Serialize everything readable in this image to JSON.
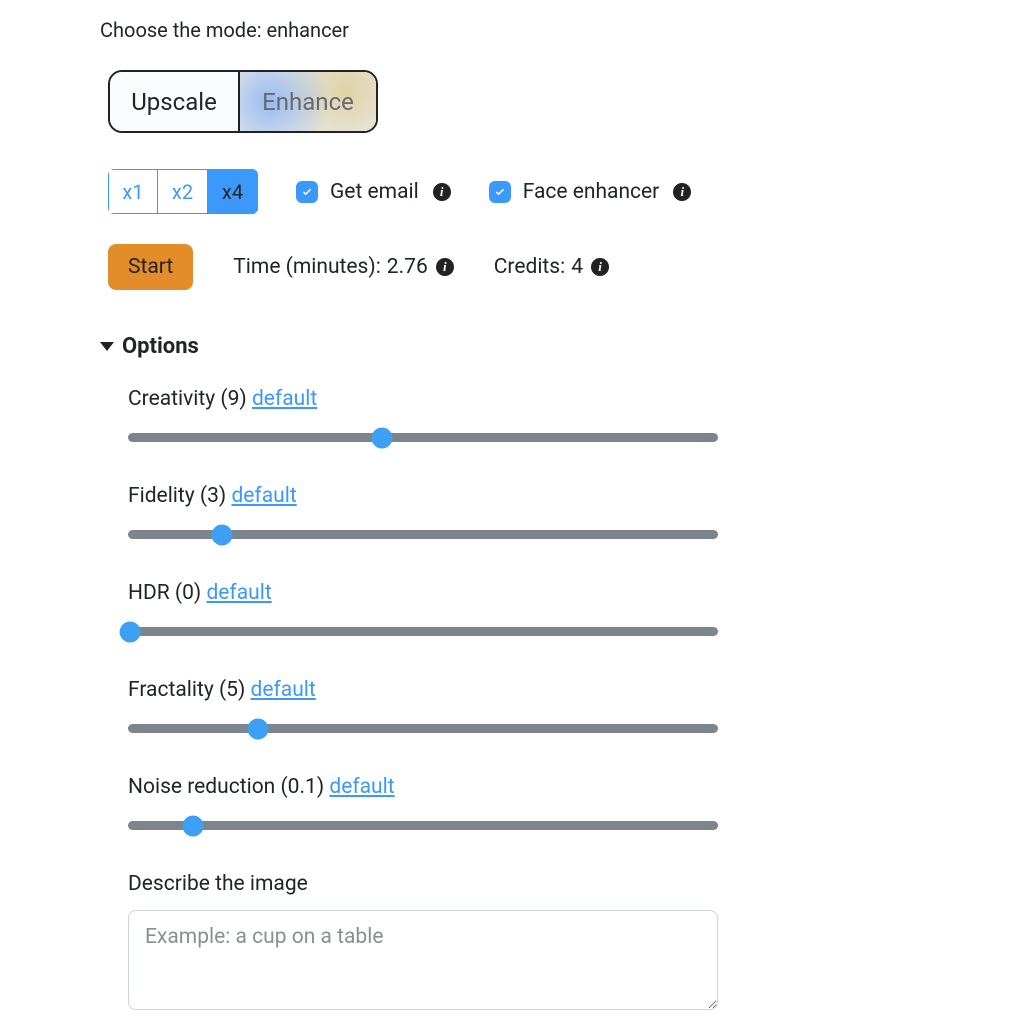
{
  "header": {
    "mode_prefix": "Choose the mode: ",
    "mode_value": "enhancer"
  },
  "mode_tabs": {
    "upscale": "Upscale",
    "enhance": "Enhance",
    "active": "enhance"
  },
  "scale": {
    "options": [
      "x1",
      "x2",
      "x4"
    ],
    "active": "x4"
  },
  "checkboxes": {
    "get_email": {
      "label": "Get email",
      "checked": true
    },
    "face_enhancer": {
      "label": "Face enhancer",
      "checked": true
    }
  },
  "actions": {
    "start": "Start",
    "time_label": "Time (minutes): ",
    "time_value": "2.76",
    "credits_label": "Credits: ",
    "credits_value": "4"
  },
  "options": {
    "title": "Options",
    "default_link": "default",
    "sliders": {
      "creativity": {
        "label_prefix": "Creativity (",
        "value": "9",
        "label_suffix": ")",
        "percent": 43,
        "min": 0,
        "max": 20
      },
      "fidelity": {
        "label_prefix": "Fidelity (",
        "value": "3",
        "label_suffix": ")",
        "percent": 16,
        "min": 0,
        "max": 20
      },
      "hdr": {
        "label_prefix": "HDR (",
        "value": "0",
        "label_suffix": ")",
        "percent": 0,
        "min": 0,
        "max": 20
      },
      "fractality": {
        "label_prefix": "Fractality (",
        "value": "5",
        "label_suffix": ")",
        "percent": 22,
        "min": 0,
        "max": 20
      },
      "noise": {
        "label_prefix": "Noise reduction (",
        "value": "0.1",
        "label_suffix": ")",
        "percent": 11,
        "min": 0,
        "max": 1
      }
    },
    "describe": {
      "label": "Describe the image",
      "placeholder": "Example: a cup on a table",
      "value": ""
    }
  },
  "info_icon_char": "i"
}
